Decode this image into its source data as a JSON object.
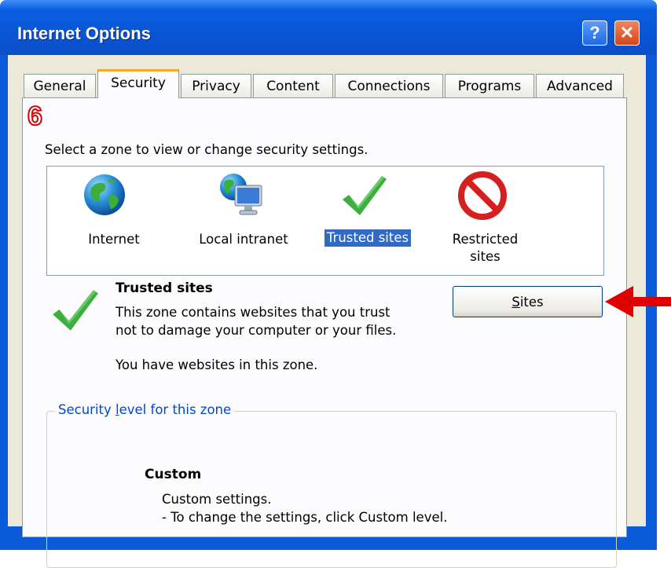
{
  "window": {
    "title": "Internet Options",
    "help_glyph": "?",
    "close_glyph": "✕"
  },
  "tabs": [
    {
      "label": "General",
      "active": false
    },
    {
      "label": "Security",
      "active": true
    },
    {
      "label": "Privacy",
      "active": false
    },
    {
      "label": "Content",
      "active": false
    },
    {
      "label": "Connections",
      "active": false
    },
    {
      "label": "Programs",
      "active": false
    },
    {
      "label": "Advanced",
      "active": false
    }
  ],
  "annotation": {
    "step_number": "6",
    "arrow_color": "#e00000"
  },
  "security": {
    "instruction": "Select a zone to view or change security settings.",
    "zones": [
      {
        "label": "Internet",
        "icon": "globe-icon",
        "selected": false
      },
      {
        "label": "Local intranet",
        "icon": "intranet-icon",
        "selected": false
      },
      {
        "label": "Trusted sites",
        "icon": "checkmark-icon",
        "selected": true
      },
      {
        "label_line1": "Restricted",
        "label_line2": "sites",
        "icon": "no-entry-icon",
        "selected": false
      }
    ],
    "selected_zone": {
      "title": "Trusted sites",
      "description": "This zone contains websites that you trust not to damage your computer or your files.",
      "status": "You have websites in this zone."
    },
    "sites_button": {
      "label_pre": "",
      "label_key": "S",
      "label_post": "ites"
    },
    "level": {
      "legend_pre": "Security ",
      "legend_key": "l",
      "legend_post": "evel for this zone",
      "name": "Custom",
      "desc_line1": "Custom settings.",
      "desc_line2": "- To change the settings, click Custom level."
    }
  },
  "colors": {
    "titlebar": "#0a55d4",
    "selection": "#316ac5",
    "active_tab_accent": "#f6a82b"
  }
}
